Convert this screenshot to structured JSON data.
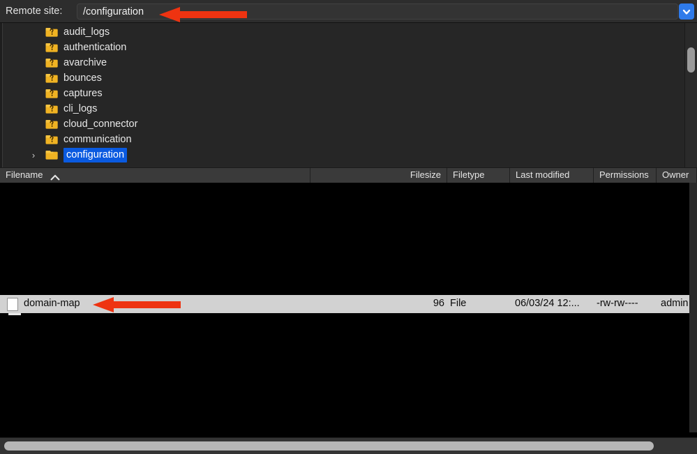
{
  "topbar": {
    "label": "Remote site:",
    "path_value": "/configuration",
    "path_placeholder": "/",
    "dropdown_icon": "chevron-down-icon",
    "accent_blue": "#2f7bea"
  },
  "tree": {
    "items": [
      {
        "label": "audit_logs",
        "icon": "folder-unknown-icon",
        "twisty": "",
        "selected": false
      },
      {
        "label": "authentication",
        "icon": "folder-unknown-icon",
        "twisty": "",
        "selected": false
      },
      {
        "label": "avarchive",
        "icon": "folder-unknown-icon",
        "twisty": "",
        "selected": false
      },
      {
        "label": "bounces",
        "icon": "folder-unknown-icon",
        "twisty": "",
        "selected": false
      },
      {
        "label": "captures",
        "icon": "folder-unknown-icon",
        "twisty": "",
        "selected": false
      },
      {
        "label": "cli_logs",
        "icon": "folder-unknown-icon",
        "twisty": "",
        "selected": false
      },
      {
        "label": "cloud_connector",
        "icon": "folder-unknown-icon",
        "twisty": "",
        "selected": false
      },
      {
        "label": "communication",
        "icon": "folder-unknown-icon",
        "twisty": "",
        "selected": false
      },
      {
        "label": "configuration",
        "icon": "folder-icon",
        "twisty": "›",
        "selected": true
      }
    ],
    "selection_color": "#0a5ae0"
  },
  "columns": [
    {
      "label": "Filename",
      "align": "left",
      "sorted": true,
      "sort_icon": "caret-up-icon"
    },
    {
      "label": "Filesize",
      "align": "right",
      "sorted": false,
      "sort_icon": ""
    },
    {
      "label": "Filetype",
      "align": "left",
      "sorted": false,
      "sort_icon": ""
    },
    {
      "label": "Last modified",
      "align": "left",
      "sorted": false,
      "sort_icon": ""
    },
    {
      "label": "Permissions",
      "align": "left",
      "sorted": false,
      "sort_icon": ""
    },
    {
      "label": "Owner",
      "align": "left",
      "sorted": false,
      "sort_icon": ""
    }
  ],
  "files": {
    "rows": [
      {
        "icon": "file-icon",
        "filename": "domain-map",
        "filesize": "96",
        "filetype": "File",
        "last_modified": "06/03/24 12:...",
        "permissions": "-rw-rw----",
        "owner": "admin",
        "selected": true
      }
    ]
  },
  "scrollbars": {
    "tree_vertical": "vertical-scrollbar",
    "list_horizontal": "horizontal-scrollbar"
  },
  "annotations": {
    "color": "#ee3311",
    "arrows": [
      {
        "name": "arrow-pointing-to-remote-site-path",
        "target": "path_value"
      },
      {
        "name": "arrow-pointing-to-domain-map-file",
        "target": "domain-map"
      }
    ]
  }
}
